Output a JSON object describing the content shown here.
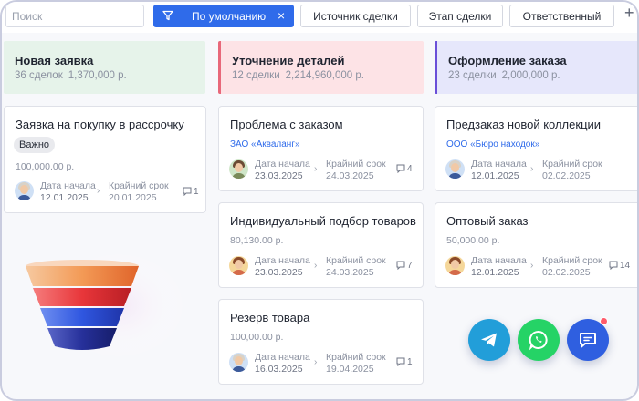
{
  "toolbar": {
    "search_placeholder": "Поиск",
    "filter_chip": "По умолчанию",
    "filter_close": "×",
    "buttons": [
      "Источник сделки",
      "Этап сделки",
      "Ответственный"
    ],
    "add": "+"
  },
  "columns": [
    {
      "title": "Новая заявка",
      "count": "36 сделок",
      "sum": "1,370,000 р.",
      "color": "#e6f3ea",
      "cards": [
        {
          "title": "Заявка на покупку в рассрочку",
          "tag": "Важно",
          "amount": "100,000.00 р.",
          "start_label": "Дата начала",
          "start": "12.01.2025",
          "due_label": "Крайний срок",
          "due": "20.01.2025",
          "comments": "1"
        }
      ]
    },
    {
      "title": "Уточнение деталей",
      "count": "12 сделки",
      "sum": "2,214,960,000 р.",
      "color": "#fde3e6",
      "accent": "#e8687a",
      "cards": [
        {
          "title": "Проблема с заказом",
          "company": "ЗАО «Акваланг»",
          "start_label": "Дата начала",
          "start": "23.03.2025",
          "due_label": "Крайний срок",
          "due": "24.03.2025",
          "comments": "4"
        },
        {
          "title": "Индивидуальный подбор товаров",
          "amount": "80,130.00 р.",
          "start_label": "Дата начала",
          "start": "23.03.2025",
          "due_label": "Крайний срок",
          "due": "24.03.2025",
          "comments": "7"
        },
        {
          "title": "Резерв товара",
          "amount": "100,00.00 р.",
          "start_label": "Дата начала",
          "start": "16.03.2025",
          "due_label": "Крайний срок",
          "due": "19.04.2025",
          "comments": "1"
        }
      ]
    },
    {
      "title": "Оформление заказа",
      "count": "23 сделки",
      "sum": "2,000,000 р.",
      "color": "#e6e7fb",
      "accent": "#6a4fd8",
      "cards": [
        {
          "title": "Предзаказ новой коллекции",
          "company": "ООО «Бюро находок»",
          "start_label": "Дата начала",
          "start": "12.01.2025",
          "due_label": "Крайний срок",
          "due": "02.02.2025",
          "comments": ""
        },
        {
          "title": "Оптовый заказ",
          "amount": "50,000.00 р.",
          "start_label": "Дата начала",
          "start": "12.01.2025",
          "due_label": "Крайний срок",
          "due": "02.02.2025",
          "comments": "14"
        }
      ]
    }
  ],
  "messengers": [
    "telegram-icon",
    "whatsapp-icon",
    "chat-icon"
  ],
  "colors": {
    "accent": "#2f6bea",
    "telegram": "#229ed9",
    "whatsapp": "#25d366",
    "chat": "#2f5fe0"
  }
}
